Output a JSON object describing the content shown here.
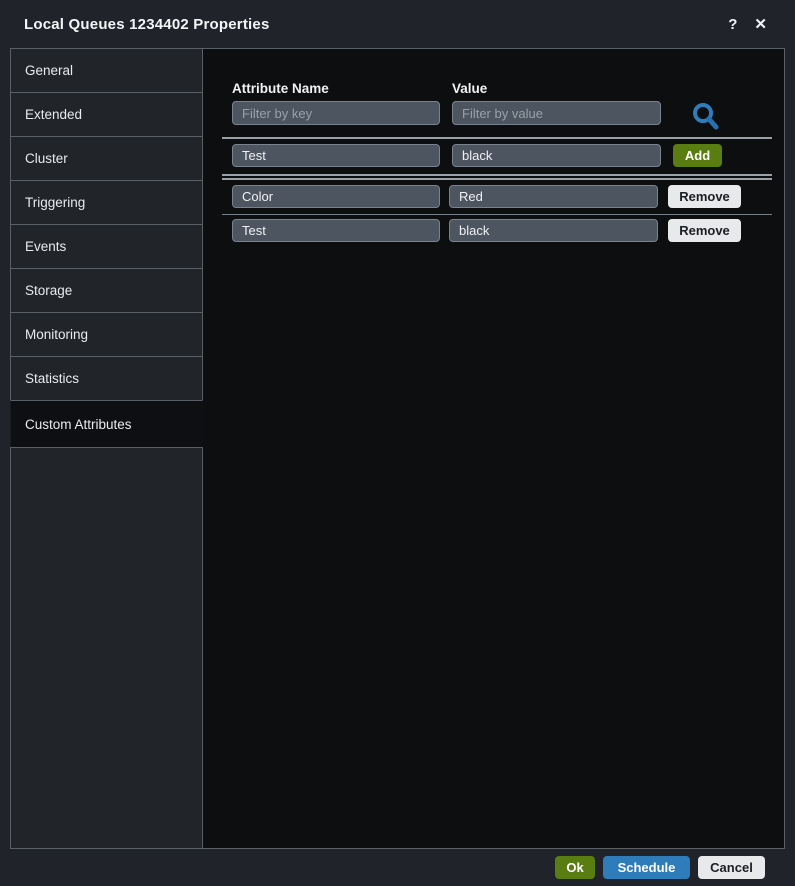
{
  "dialog": {
    "title": "Local Queues 1234402 Properties",
    "help_icon": "?",
    "close_icon": "✕"
  },
  "sidebar": {
    "tabs": [
      {
        "label": "General",
        "selected": false
      },
      {
        "label": "Extended",
        "selected": false
      },
      {
        "label": "Cluster",
        "selected": false
      },
      {
        "label": "Triggering",
        "selected": false
      },
      {
        "label": "Events",
        "selected": false
      },
      {
        "label": "Storage",
        "selected": false
      },
      {
        "label": "Monitoring",
        "selected": false
      },
      {
        "label": "Statistics",
        "selected": false
      },
      {
        "label": "Custom Attributes",
        "selected": true
      }
    ]
  },
  "main": {
    "headers": {
      "attribute_name": "Attribute Name",
      "value": "Value"
    },
    "filters": {
      "key_placeholder": "Filter by key",
      "value_placeholder": "Filter by value"
    },
    "add_row": {
      "name": "Test",
      "value": "black",
      "button_label": "Add"
    },
    "rows": [
      {
        "name": "Color",
        "value": "Red",
        "button_label": "Remove"
      },
      {
        "name": "Test",
        "value": "black",
        "button_label": "Remove"
      }
    ]
  },
  "footer": {
    "ok_label": "Ok",
    "schedule_label": "Schedule",
    "cancel_label": "Cancel"
  },
  "colors": {
    "accent_green": "#597d11",
    "accent_blue": "#2e7cba",
    "button_light": "#e8e9eb",
    "panel_black": "#0c0e10",
    "dialog_bg": "#202329"
  }
}
